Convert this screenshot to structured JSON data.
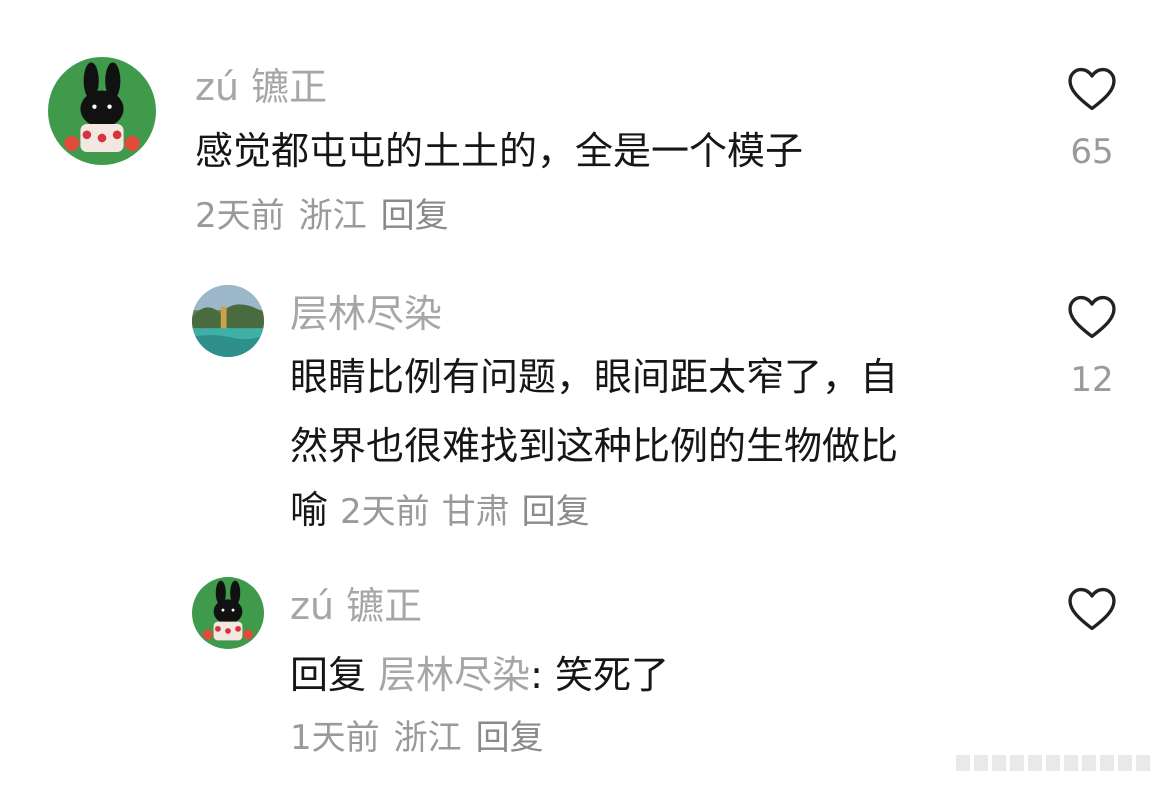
{
  "comments": [
    {
      "name": "zú 镳正",
      "lines": [
        "感觉都屯屯的土土的，全是一个模子"
      ],
      "time": "2天前",
      "location": "浙江",
      "reply_label": "回复",
      "likes": "65",
      "avatar": "miffy-green-avatar"
    },
    {
      "name": "层林尽染",
      "lines": [
        "眼睛比例有问题，眼间距太窄了，自",
        "然界也很难找到这种比例的生物做比",
        "喻"
      ],
      "time": "2天前",
      "location": "甘肃",
      "reply_label": "回复",
      "likes": "12",
      "avatar": "landscape-lake-avatar"
    },
    {
      "name": "zú 镳正",
      "reply_prefix": "回复",
      "reply_to": "层林尽染",
      "reply_sep": ":",
      "reply_text": "笑死了",
      "time": "1天前",
      "location": "浙江",
      "reply_label": "回复",
      "avatar": "miffy-green-avatar"
    }
  ],
  "colors": {
    "avatar_green": "#3f9a4b",
    "name_gray": "#a6a6a6",
    "meta_gray": "#9a9a9a",
    "text": "#161616"
  }
}
